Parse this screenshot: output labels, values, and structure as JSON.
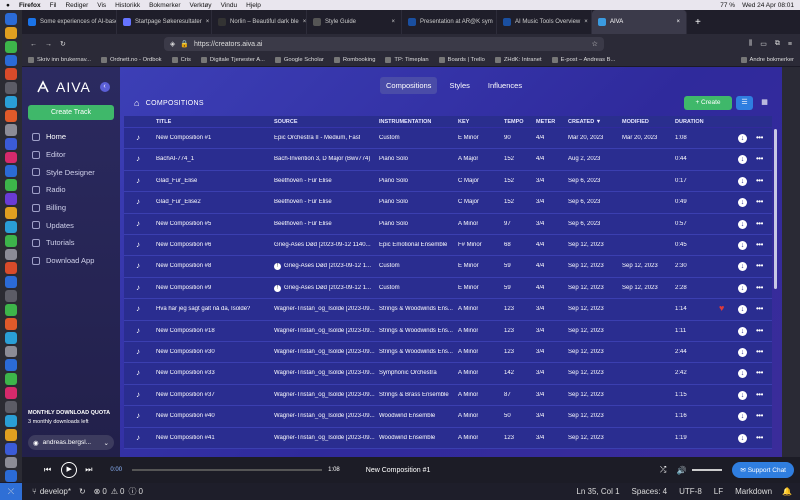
{
  "menubar": {
    "apple": "",
    "items": [
      "Firefox",
      "Fil",
      "Rediger",
      "Vis",
      "Historikk",
      "Bokmerker",
      "Verktøy",
      "Vindu",
      "Hjelp"
    ],
    "right": [
      "77 %",
      "Wed 24 Apr 08:01"
    ]
  },
  "tabs": [
    {
      "label": "Some experiences of AI-base",
      "color": "#1a73e8"
    },
    {
      "label": "Startpage Søkeresultater",
      "color": "#6573ff"
    },
    {
      "label": "Norlin – Beautiful dark ble",
      "color": "#333"
    },
    {
      "label": "Style Guide",
      "color": "#555"
    },
    {
      "label": "Presentation at AR@K sym",
      "color": "#1a4fa0"
    },
    {
      "label": "AI Music Tools Overview",
      "color": "#1a4fa0"
    },
    {
      "label": "AIVA",
      "color": "#3b9be0",
      "active": true
    }
  ],
  "nav": {
    "url": "https://creators.aiva.ai"
  },
  "bookmarks": [
    "Skriv inn brukernav...",
    "Ordnett.no - Ordbok",
    "Cris",
    "Digitale Tjenester A...",
    "Google Scholar",
    "Rombooking",
    "TP: Timeplan",
    "Boards | Trello",
    "ZHdK: Intranet",
    "E-post – Andreas B...",
    "Andre bokmerker"
  ],
  "sidebar": {
    "logo": "AIVA",
    "create_label": "Create Track",
    "items": [
      {
        "label": "Home",
        "active": true
      },
      {
        "label": "Editor"
      },
      {
        "label": "Style Designer"
      },
      {
        "label": "Radio"
      },
      {
        "label": "Billing"
      },
      {
        "label": "Updates"
      },
      {
        "label": "Tutorials"
      },
      {
        "label": "Download App"
      }
    ],
    "quota_title": "MONTHLY DOWNLOAD QUOTA",
    "quota_text": "3 monthly downloads left",
    "user": "andreas.bergsl..."
  },
  "topnav": [
    "Compositions",
    "Styles",
    "Influences"
  ],
  "page_title": "COMPOSITIONS",
  "new_label": "+ Create",
  "columns": [
    "TITLE",
    "SOURCE",
    "INSTRUMENTATION",
    "KEY",
    "TEMPO",
    "METER",
    "CREATED ▼",
    "MODIFIED",
    "DURATION"
  ],
  "rows": [
    {
      "title": "New Composition #1",
      "source": "Epic Orchestra II - Medium, Fast",
      "instr": "Custom",
      "key": "E Minor",
      "tempo": "90",
      "meter": "4/4",
      "created": "Mar 20, 2023",
      "modified": "Mar 20, 2023",
      "duration": "1:08"
    },
    {
      "title": "BachAI-774_1",
      "source": "Bach-Invention 3, D Major (Bwv774)",
      "instr": "Piano Solo",
      "key": "A Major",
      "tempo": "152",
      "meter": "4/4",
      "created": "Aug 2, 2023",
      "modified": "",
      "duration": "0:44"
    },
    {
      "title": "Glad_Fur_Elise",
      "source": "Beethoven - Für Elise",
      "instr": "Piano Solo",
      "key": "C Major",
      "tempo": "152",
      "meter": "3/4",
      "created": "Sep 6, 2023",
      "modified": "",
      "duration": "0:17"
    },
    {
      "title": "Glad_Fur_Elise2",
      "source": "Beethoven - Für Elise",
      "instr": "Piano Solo",
      "key": "C Major",
      "tempo": "152",
      "meter": "3/4",
      "created": "Sep 6, 2023",
      "modified": "",
      "duration": "0:49"
    },
    {
      "title": "New Composition #5",
      "source": "Beethoven - Für Elise",
      "instr": "Piano Solo",
      "key": "A Minor",
      "tempo": "97",
      "meter": "3/4",
      "created": "Sep 6, 2023",
      "modified": "",
      "duration": "0:57"
    },
    {
      "title": "New Composition #6",
      "source": "Grieg-Åses Død [2023-09-12 1140...",
      "instr": "Epic Emotional Ensemble",
      "key": "F# Minor",
      "tempo": "68",
      "meter": "4/4",
      "created": "Sep 12, 2023",
      "modified": "",
      "duration": "0:45"
    },
    {
      "title": "New Composition #8",
      "source": "Grieg-Åses Død [2023-09-12 1...",
      "instr": "Custom",
      "key": "E Minor",
      "tempo": "59",
      "meter": "4/4",
      "created": "Sep 12, 2023",
      "modified": "Sep 12, 2023",
      "duration": "2:30",
      "warn": true
    },
    {
      "title": "New Composition #9",
      "source": "Grieg-Åses Død [2023-09-12 1...",
      "instr": "Custom",
      "key": "E Minor",
      "tempo": "59",
      "meter": "4/4",
      "created": "Sep 12, 2023",
      "modified": "Sep 12, 2023",
      "duration": "2:28",
      "warn": true
    },
    {
      "title": "Hva har jeg sagt galt nå da, Isolde?",
      "source": "Wagner-Tristan_og_Isolde [2023-09...",
      "instr": "Strings & Woodwinds Ens...",
      "key": "A Minor",
      "tempo": "123",
      "meter": "3/4",
      "created": "Sep 12, 2023",
      "modified": "",
      "duration": "1:14",
      "heart": true
    },
    {
      "title": "New Composition #18",
      "source": "Wagner-Tristan_og_Isolde [2023-09...",
      "instr": "Strings & Woodwinds Ens...",
      "key": "A Minor",
      "tempo": "123",
      "meter": "3/4",
      "created": "Sep 12, 2023",
      "modified": "",
      "duration": "1:11"
    },
    {
      "title": "New Composition #30",
      "source": "Wagner-Tristan_og_Isolde [2023-09...",
      "instr": "Strings & Woodwinds Ens...",
      "key": "A Minor",
      "tempo": "123",
      "meter": "3/4",
      "created": "Sep 12, 2023",
      "modified": "",
      "duration": "2:44"
    },
    {
      "title": "New Composition #33",
      "source": "Wagner-Tristan_og_Isolde [2023-09...",
      "instr": "Symphonic Orchestra",
      "key": "A Minor",
      "tempo": "142",
      "meter": "3/4",
      "created": "Sep 12, 2023",
      "modified": "",
      "duration": "2:42"
    },
    {
      "title": "New Composition #37",
      "source": "Wagner-Tristan_og_Isolde [2023-09...",
      "instr": "Strings & Brass Ensemble",
      "key": "A Minor",
      "tempo": "87",
      "meter": "3/4",
      "created": "Sep 12, 2023",
      "modified": "",
      "duration": "1:15"
    },
    {
      "title": "New Composition #40",
      "source": "Wagner-Tristan_og_Isolde [2023-09...",
      "instr": "Woodwind Ensemble",
      "key": "A Minor",
      "tempo": "50",
      "meter": "3/4",
      "created": "Sep 12, 2023",
      "modified": "",
      "duration": "1:16"
    },
    {
      "title": "New Composition #41",
      "source": "Wagner-Tristan_og_Isolde [2023-09...",
      "instr": "Woodwind Ensemble",
      "key": "A Minor",
      "tempo": "123",
      "meter": "3/4",
      "created": "Sep 12, 2023",
      "modified": "",
      "duration": "1:19"
    }
  ],
  "player": {
    "current": "0:00",
    "total": "1:08",
    "title": "New Composition #1",
    "support": "Support Chat"
  },
  "statusbar": {
    "branch": "develop*",
    "errors": "0",
    "warnings": "0",
    "info": "0",
    "position": "Ln 35, Col 1",
    "spaces": "Spaces: 4",
    "encoding": "UTF-8",
    "eol": "LF",
    "lang": "Markdown"
  },
  "colors": {
    "accent": "#3fb86a",
    "main": "#3336a6",
    "sidebar": "#2b2a60"
  }
}
